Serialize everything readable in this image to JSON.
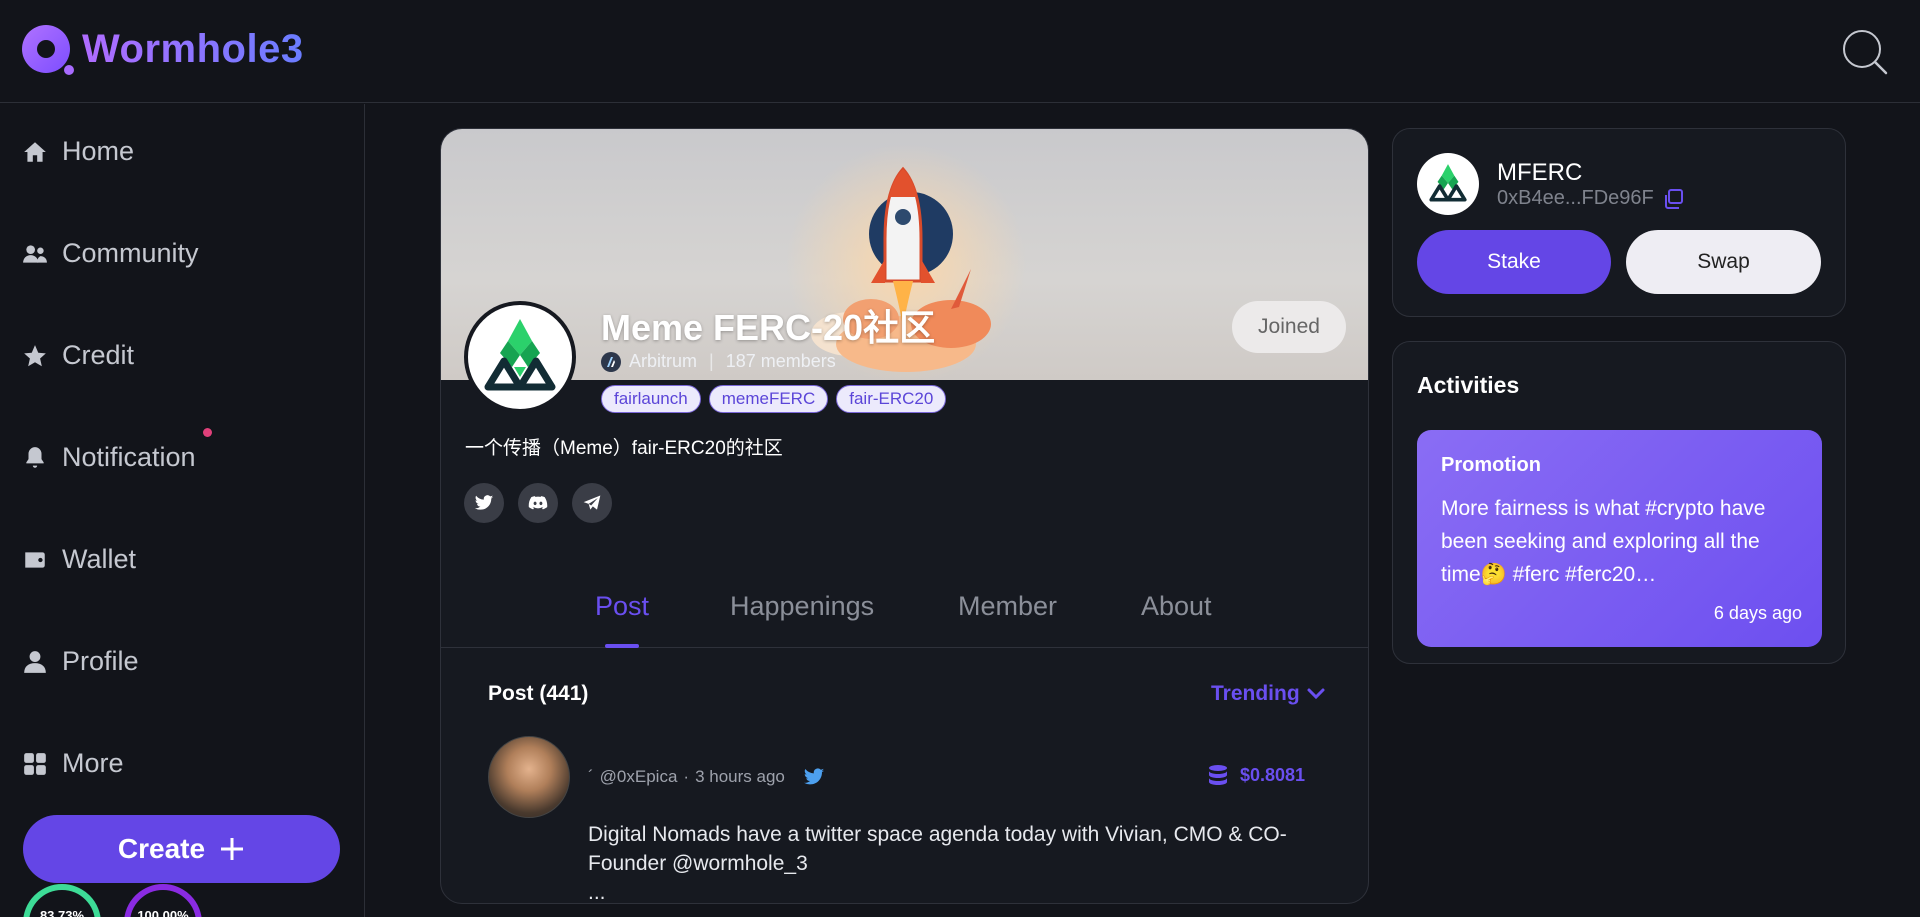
{
  "header": {
    "app_name": "Wormhole3",
    "search_icon": "search-icon"
  },
  "sidebar": {
    "items": [
      {
        "label": "Home",
        "icon": "home-icon"
      },
      {
        "label": "Community",
        "icon": "community-icon"
      },
      {
        "label": "Credit",
        "icon": "star-icon"
      },
      {
        "label": "Notification",
        "icon": "bell-icon",
        "has_unread": true
      },
      {
        "label": "Wallet",
        "icon": "wallet-icon"
      },
      {
        "label": "Profile",
        "icon": "profile-icon"
      },
      {
        "label": "More",
        "icon": "grid-icon"
      }
    ],
    "create_label": "Create",
    "gauges": [
      {
        "label": "83.73%",
        "value": 0.8373,
        "color": "#3ddc97"
      },
      {
        "label": "100.00%",
        "value": 1.0,
        "color": "#8a2be2"
      }
    ]
  },
  "community": {
    "title": "Meme FERC-20社区",
    "chain": "Arbitrum",
    "members": "187 members",
    "joined_label": "Joined",
    "tags": [
      "fairlaunch",
      "memeFERC",
      "fair-ERC20"
    ],
    "description": "一个传播（Meme）fair-ERC20的社区",
    "socials": [
      "twitter-icon",
      "discord-icon",
      "telegram-icon"
    ],
    "tabs": [
      {
        "label": "Post",
        "active": true
      },
      {
        "label": "Happenings",
        "active": false
      },
      {
        "label": "Member",
        "active": false
      },
      {
        "label": "About",
        "active": false
      }
    ]
  },
  "posts": {
    "count_label": "Post (441)",
    "sort_label": "Trending",
    "first": {
      "author_prefix": "´",
      "handle": "@0xEpica",
      "dot": "·",
      "time": "3 hours ago",
      "price": "$0.8081",
      "body": "Digital Nomads have a twitter space agenda today with Vivian, CMO & CO-Founder @wormhole_3",
      "ellipsis": "..."
    }
  },
  "token": {
    "name": "MFERC",
    "address": "0xB4ee...FDe96F",
    "stake_label": "Stake",
    "swap_label": "Swap"
  },
  "activities": {
    "title": "Activities",
    "promo_title": "Promotion",
    "promo_text": "More fairness is what #crypto have been seeking and exploring all the time🤔 #ferc #ferc20…",
    "promo_time": "6 days ago"
  },
  "colors": {
    "accent": "#6446e6",
    "background": "#12141a",
    "notification": "#e0407a"
  }
}
